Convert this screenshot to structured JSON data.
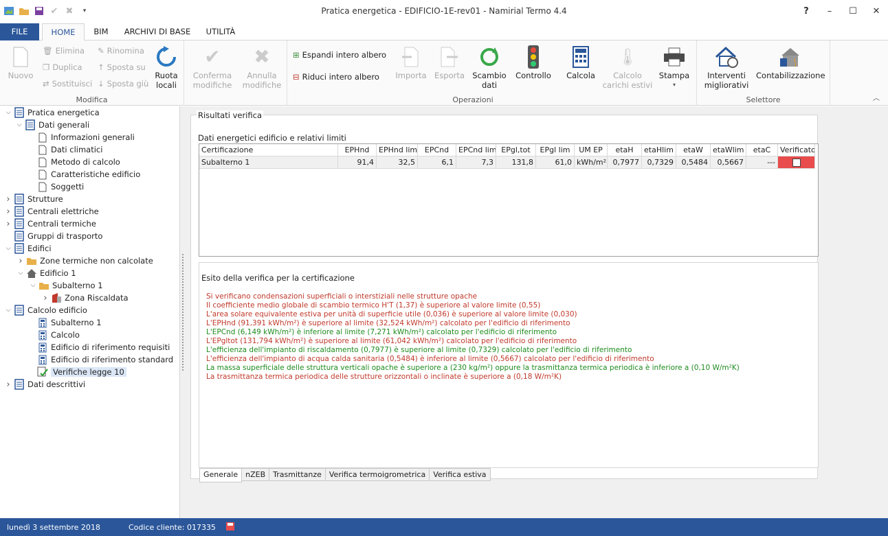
{
  "window": {
    "title": "Pratica energetica - EDIFICIO-1E-rev01 - Namirial Termo 4.4",
    "help": "?",
    "minimize": "–",
    "maximize": "☐",
    "close": "✕"
  },
  "tabs": {
    "file": "FILE",
    "home": "HOME",
    "bim": "BIM",
    "archivi": "ARCHIVI DI BASE",
    "utilita": "UTILITÀ"
  },
  "ribbon": {
    "nuovo": "Nuovo",
    "elimina": "Elimina",
    "duplica": "Duplica",
    "sostituisci": "Sostituisci",
    "rinomina": "Rinomina",
    "sposta_su": "Sposta su",
    "sposta_giu": "Sposta giù",
    "ruota_1": "Ruota",
    "ruota_2": "locali",
    "group_modifica": "Modifica",
    "conferma_1": "Conferma",
    "conferma_2": "modifiche",
    "annulla_1": "Annulla",
    "annulla_2": "modifiche",
    "espandi": "Espandi intero albero",
    "riduci": "Riduci intero albero",
    "importa": "Importa",
    "esporta": "Esporta",
    "scambio_1": "Scambio",
    "scambio_2": "dati",
    "controllo": "Controllo",
    "group_operazioni": "Operazioni",
    "calcola": "Calcola",
    "carichi_1": "Calcolo",
    "carichi_2": "carichi estivi",
    "stampa": "Stampa",
    "interventi_1": "Interventi",
    "interventi_2": "migliorativi",
    "contab": "Contabilizzazione",
    "group_selettore": "Selettore"
  },
  "tree": [
    {
      "label": "Pratica energetica"
    },
    {
      "label": "Dati generali"
    },
    {
      "label": "Informazioni generali"
    },
    {
      "label": "Dati climatici"
    },
    {
      "label": "Metodo di calcolo"
    },
    {
      "label": "Caratteristiche edificio"
    },
    {
      "label": "Soggetti"
    },
    {
      "label": "Strutture"
    },
    {
      "label": "Centrali elettriche"
    },
    {
      "label": "Centrali termiche"
    },
    {
      "label": "Gruppi di trasporto"
    },
    {
      "label": "Edifici"
    },
    {
      "label": "Zone termiche non calcolate"
    },
    {
      "label": "Edificio 1"
    },
    {
      "label": "Subalterno 1"
    },
    {
      "label": "Zona Riscaldata"
    },
    {
      "label": "Calcolo edificio"
    },
    {
      "label": "Subalterno 1"
    },
    {
      "label": "Calcolo"
    },
    {
      "label": "Edificio di riferimento requisiti"
    },
    {
      "label": "Edificio di riferimento standard"
    },
    {
      "label": "Verifiche legge 10"
    },
    {
      "label": "Dati descrittivi"
    }
  ],
  "results": {
    "legend": "Risultati verifica",
    "subtitle": "Dati energetici edificio e relativi limiti",
    "headers": [
      "Certificazione",
      "EPHnd",
      "EPHnd lim",
      "EPCnd",
      "EPCnd lim",
      "EPgl,tot",
      "EPgl lim",
      "UM EP",
      "etaH",
      "etaHlim",
      "etaW",
      "etaWlim",
      "etaC",
      "Verificato"
    ],
    "row": [
      "Subalterno 1",
      "91,4",
      "32,5",
      "6,1",
      "7,3",
      "131,8",
      "61,0",
      "kWh/m²",
      "0,7977",
      "0,7329",
      "0,5484",
      "0,5667",
      "---"
    ]
  },
  "esito": {
    "title": "Esito della verifica per la certificazione",
    "messages": [
      "Si verificano condensazioni superficiali o interstiziali nelle strutture opache",
      "Il coefficiente medio globale di scambio termico H'T (1,37) è superiore al valore limite (0,55)",
      "L'area solare equivalente estiva per unità di superficie utile (0,036) è superiore al valore limite (0,030)",
      "L'EPHnd (91,391 kWh/m²) è superiore al limite (32,524 kWh/m²) calcolato per l'edificio di riferimento",
      "L'EPCnd (6,149 kWh/m²) è inferiore al limite (7,271 kWh/m²) calcolato per l'edificio di riferimento",
      "L'EPgltot (131,794 kWh/m²) è superiore al limite (61,042 kWh/m²) calcolato per l'edificio di riferimento",
      "L'efficienza dell'impianto di riscaldamento (0,7977) è superiore al limite (0,7329) calcolato per l'edificio di riferimento",
      "L'efficienza dell'impianto di acqua calda sanitaria (0,5484) è inferiore al limite (0,5667) calcolato per l'edificio di riferimento",
      "La massa superficiale delle struttura verticali opache è superiore a (230 kg/m²) oppure la trasmittanza termica periodica è inferiore a (0,10 W/m²K)",
      "La trasmittanza termica periodica delle strutture orizzontali o inclinate è superiore a (0,18 W/m²K)"
    ],
    "colors": {
      "fail": "#c0392b",
      "ok": "#1e8b1e"
    }
  },
  "bottom_tabs": [
    "Generale",
    "nZEB",
    "Trasmittanze",
    "Verifica termoigrometrica",
    "Verifica estiva"
  ],
  "status": {
    "date": "lunedì 3 settembre 2018",
    "client": "Codice cliente: 017335"
  },
  "colors": {
    "accent": "#2b579a",
    "fail_cell": "#e84c4c"
  }
}
